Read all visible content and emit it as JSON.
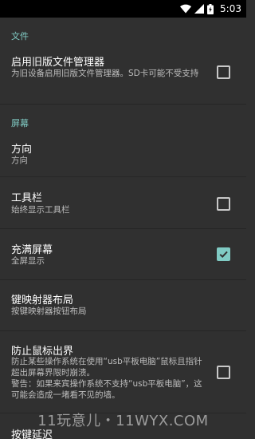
{
  "status_bar": {
    "time": "5:03",
    "icons": [
      "wifi-icon",
      "signal-icon",
      "battery-icon"
    ]
  },
  "colors": {
    "background": "#303030",
    "accent": "#80cbc4",
    "primary_text": "#ffffff",
    "secondary_text": "#bdbdbd"
  },
  "sections": {
    "files": {
      "header": "文件",
      "items": [
        {
          "title": "启用旧版文件管理器",
          "summary": "为旧设备启用旧版文件管理器。SD卡可能不受支持",
          "checked": false
        }
      ]
    },
    "screen": {
      "header": "屏幕",
      "items": [
        {
          "title": "方向",
          "summary": "方向"
        },
        {
          "title": "工具栏",
          "summary": "始终显示工具栏",
          "checked": false
        },
        {
          "title": "充满屏幕",
          "summary": "全屏显示",
          "checked": true
        },
        {
          "title": "键映射器布局",
          "summary": "按键映射器按钮布局"
        },
        {
          "title": "防止鼠标出界",
          "summary": "防止某些操作系统在使用“usb平板电脑”鼠标且指针超出屏幕界限时崩溃。\n警告：如果来宾操作系统不支持“usb平板电脑”，这可能会造成一堵看不见的墙。",
          "checked": false
        },
        {
          "title": "按键延迟"
        }
      ]
    }
  },
  "watermark": "11玩意儿・11WYX.COM"
}
